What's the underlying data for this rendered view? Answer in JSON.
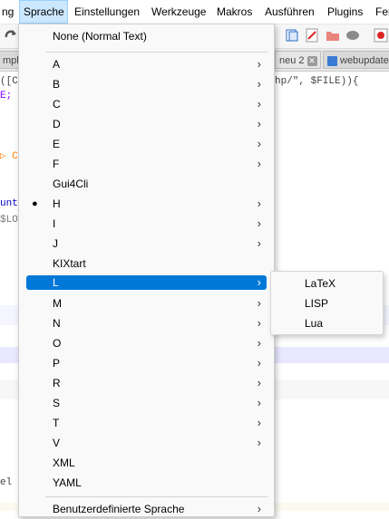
{
  "menubar": {
    "items": [
      "ng",
      "Sprache",
      "Einstellungen",
      "Werkzeuge",
      "Makros",
      "Ausführen",
      "Plugins",
      "Fer"
    ],
    "active": "Sprache"
  },
  "toolbar": {
    "icons": [
      "redo-icon",
      "find-in-files-icon",
      "function-list-icon",
      "macro-record-icon",
      "folder-icon",
      "monitor-icon",
      "stop-icon"
    ]
  },
  "tabs": [
    {
      "label": "mple"
    },
    {
      "label": "neu 2",
      "close": "✕"
    },
    {
      "label": "webupdate"
    }
  ],
  "editor": {
    "lines": [
      {
        "text": "([C",
        "right_text": "hp/\", $FILE)){"
      },
      {
        "text": "E;"
      },
      {
        "text": "▷ C"
      },
      {
        "text": "unt"
      },
      {
        "text": "$LO"
      },
      {
        "text": "el"
      }
    ]
  },
  "language_menu": {
    "items": [
      {
        "label": "None (Normal Text)",
        "submenu": false
      },
      {
        "label": "A",
        "submenu": true
      },
      {
        "label": "B",
        "submenu": true
      },
      {
        "label": "C",
        "submenu": true
      },
      {
        "label": "D",
        "submenu": true
      },
      {
        "label": "E",
        "submenu": true
      },
      {
        "label": "F",
        "submenu": true
      },
      {
        "label": "Gui4Cli",
        "submenu": false
      },
      {
        "label": "H",
        "submenu": true,
        "bullet": "●"
      },
      {
        "label": "I",
        "submenu": true
      },
      {
        "label": "J",
        "submenu": true
      },
      {
        "label": "KIXtart",
        "submenu": false
      },
      {
        "label": "L",
        "submenu": true,
        "highlighted": true
      },
      {
        "label": "M",
        "submenu": true
      },
      {
        "label": "N",
        "submenu": true
      },
      {
        "label": "O",
        "submenu": true
      },
      {
        "label": "P",
        "submenu": true
      },
      {
        "label": "R",
        "submenu": true
      },
      {
        "label": "S",
        "submenu": true
      },
      {
        "label": "T",
        "submenu": true
      },
      {
        "label": "V",
        "submenu": true
      },
      {
        "label": "XML",
        "submenu": false
      },
      {
        "label": "YAML",
        "submenu": false
      },
      {
        "label": "Benutzerdefinierte Sprache",
        "submenu": true
      }
    ],
    "arrow_glyph": "›"
  },
  "l_submenu": {
    "items": [
      "LaTeX",
      "LISP",
      "Lua"
    ]
  },
  "colors": {
    "highlight": "#0078d7",
    "menu_bg": "#f9f9f9",
    "menubar_active": "#cce8ff"
  }
}
